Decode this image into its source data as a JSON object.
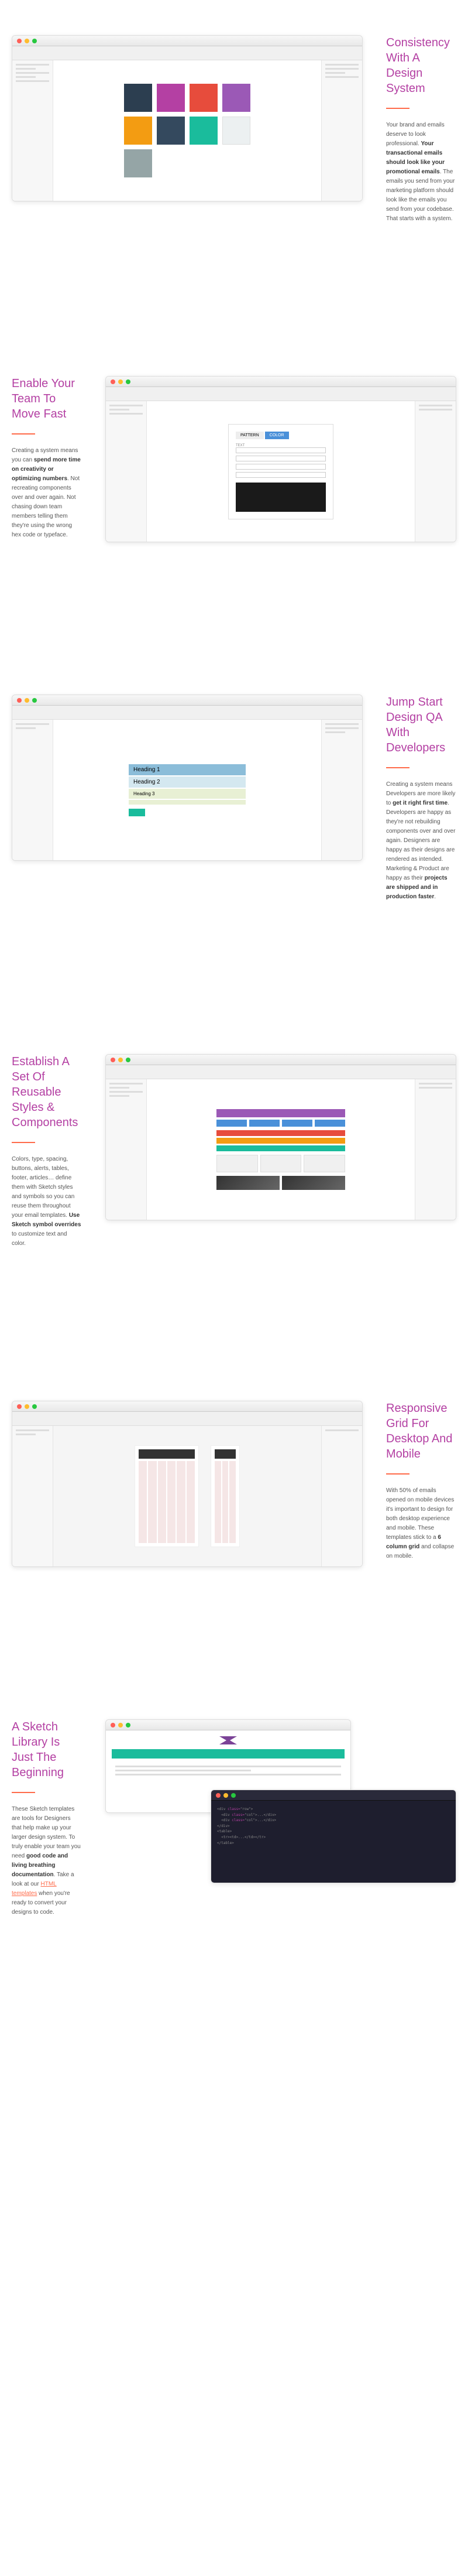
{
  "sections": [
    {
      "heading": "Consistency With A Design System",
      "body_pre": "Your brand and emails deserve to look professional. ",
      "body_bold1": "Your transactional emails should look like your promotional emails",
      "body_post": ". The emails you send from your marketing platform should look like the emails you send from your codebase. That starts with a system."
    },
    {
      "heading": "Enable Your Team To Move Fast",
      "body_pre": "Creating a system means you can ",
      "body_bold1": "spend more time on creativity or optimizing numbers",
      "body_post": ". Not recreating components over and over again. Not chasing down team members telling them they're using the wrong hex code or typeface."
    },
    {
      "heading": "Jump Start Design QA With Developers",
      "body_pre": "Creating a system means Developers are more likely to ",
      "body_bold1": "get it right first time",
      "body_mid": ". Developers are happy as they're not rebuilding components over and over again. Designers are happy as their designs are rendered as intended. Marketing & Product are happy as their ",
      "body_bold2": "projects are shipped and in production faster",
      "body_post": "."
    },
    {
      "heading": "Establish A Set Of Reusable Styles & Components",
      "body_pre": "Colors, type, spacing, buttons, alerts, tables, footer, articles… define them with Sketch styles and symbols so you can reuse them throughout your email templates. ",
      "body_bold1": "Use Sketch symbol overrides",
      "body_post": " to customize text and color."
    },
    {
      "heading": "Responsive Grid For Desktop And Mobile",
      "body_pre": "With 50% of emails opened on mobile devices it's important to design for both desktop experience and mobile. These templates stick to a ",
      "body_bold1": "6 column grid",
      "body_post": " and collapse on mobile."
    },
    {
      "heading": "A Sketch Library Is Just The Beginning",
      "body_pre": "These Sketch templates are tools for Designers that help make up your larger design system. To truly enable your team you need ",
      "body_bold1": "good code and living breathing documentation",
      "body_mid": ". Take a look at our ",
      "body_link": "HTML templates",
      "body_post": " when you're ready to convert your designs to code."
    }
  ],
  "mock": {
    "heading1": "Heading 1",
    "heading2": "Heading 2",
    "heading3": "Heading 3",
    "tab_pattern": "PATTERN",
    "tab_color": "COLOR",
    "field_text": "TEXT"
  }
}
